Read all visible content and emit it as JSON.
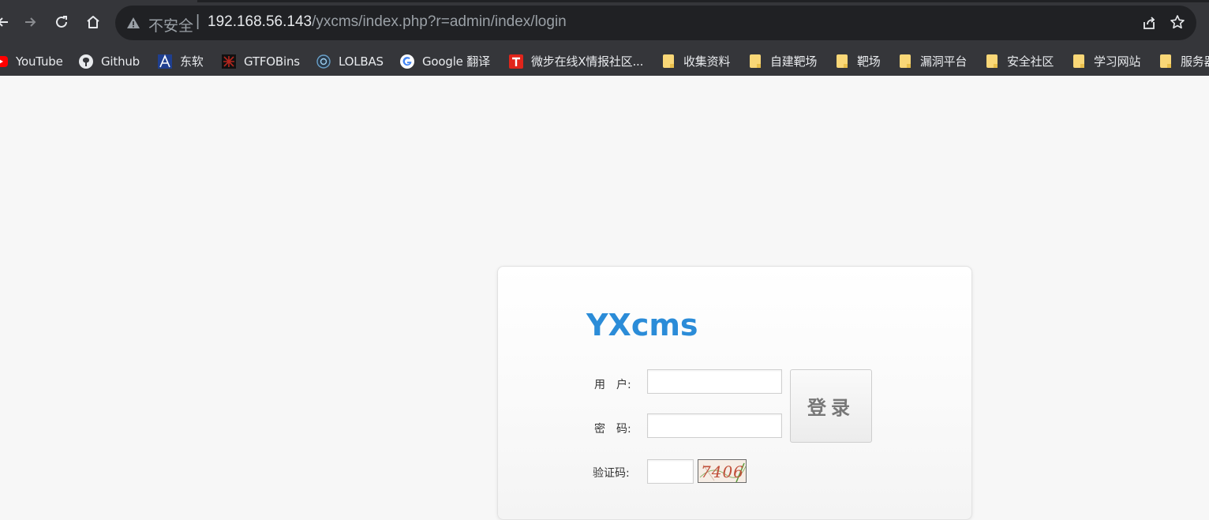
{
  "browser": {
    "insecure_label": "不安全",
    "separator": "|",
    "url_host": "192.168.56.143",
    "url_path": "/yxcms/index.php?r=admin/index/login",
    "icons": [
      "back-icon",
      "forward-icon",
      "reload-icon",
      "home-icon",
      "warning-icon",
      "share-icon",
      "star-icon"
    ]
  },
  "bookmarks": [
    {
      "label": "YouTube",
      "icon": "youtube-icon"
    },
    {
      "label": "Github",
      "icon": "github-icon"
    },
    {
      "label": "东软",
      "icon": "neusoft-icon"
    },
    {
      "label": "GTFOBins",
      "icon": "gtfobins-icon"
    },
    {
      "label": "LOLBAS",
      "icon": "lolbas-icon"
    },
    {
      "label": "Google 翻译",
      "icon": "google-icon"
    },
    {
      "label": "微步在线X情报社区...",
      "icon": "threatbook-icon"
    },
    {
      "label": "收集资料",
      "icon": "folder-icon"
    },
    {
      "label": "自建靶场",
      "icon": "folder-icon"
    },
    {
      "label": "靶场",
      "icon": "folder-icon"
    },
    {
      "label": "漏洞平台",
      "icon": "folder-icon"
    },
    {
      "label": "安全社区",
      "icon": "folder-icon"
    },
    {
      "label": "学习网站",
      "icon": "folder-icon"
    },
    {
      "label": "服务器",
      "icon": "folder-icon"
    }
  ],
  "login": {
    "logo": "YXcms",
    "username_label": "用　户:",
    "password_label": "密　码:",
    "captcha_label": "验证码:",
    "username_value": "",
    "password_value": "",
    "captcha_value": "",
    "captcha_image_text": "7406",
    "submit_label": "登录"
  },
  "colors": {
    "brand": "#2b8cd8",
    "chrome_bg": "#35363a",
    "page_bg": "#f7f7f7"
  }
}
